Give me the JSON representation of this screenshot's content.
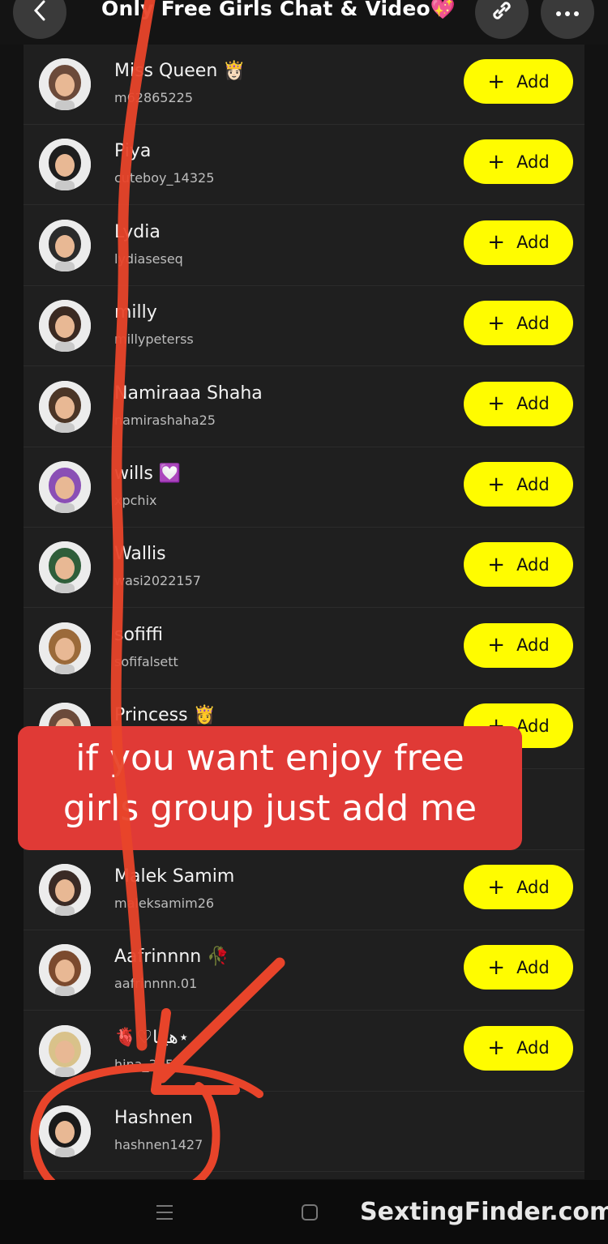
{
  "header": {
    "title": "Only Free Girls Chat & Video💖",
    "back_icon": "chevron-left-icon",
    "link_icon": "link-icon",
    "more_icon": "more-dots-icon"
  },
  "add_label": "Add",
  "contacts": [
    {
      "name": "Miss Queen 👸🏻",
      "username": "m62865225",
      "add": true
    },
    {
      "name": "Piya",
      "username": "cuteboy_14325",
      "add": true
    },
    {
      "name": "Lydia",
      "username": "lydiaseseq",
      "add": true
    },
    {
      "name": "milly",
      "username": "millypeterss",
      "add": true
    },
    {
      "name": "Namiraaa Shaha",
      "username": "namirashaha25",
      "add": true
    },
    {
      "name": "wills 💟",
      "username": "xpchix",
      "add": true
    },
    {
      "name": "Wallis",
      "username": "wasi2022157",
      "add": true
    },
    {
      "name": "sofiffi",
      "username": "sofifalsett",
      "add": true
    },
    {
      "name": "Princess 👸",
      "username": "",
      "add": true
    },
    {
      "name": "",
      "username": "",
      "add": false
    },
    {
      "name": "Malek Samim",
      "username": "maleksamim26",
      "add": true
    },
    {
      "name": "Aafrinnnn 🥀",
      "username": "aafrinnnn.01",
      "add": true
    },
    {
      "name": "🫀♡هينا⋆",
      "username": "hina_3950",
      "add": true
    },
    {
      "name": "Hashnen",
      "username": "hashnen1427",
      "add": false
    }
  ],
  "banner": {
    "line1": "if you want enjoy free",
    "line2": "girls group just add me"
  },
  "watermark": "SextingFinder.com",
  "colors": {
    "accent": "#fffc00",
    "banner": "#e03a36",
    "annotation": "#e8442a",
    "background": "#121212"
  }
}
